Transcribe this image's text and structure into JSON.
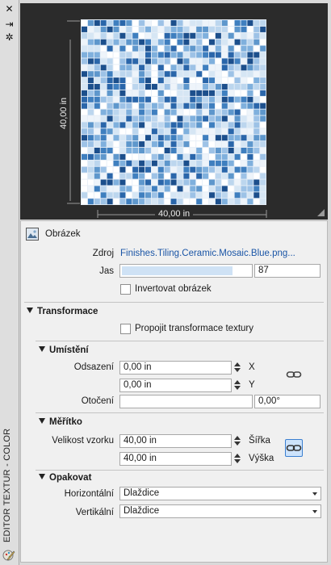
{
  "palette_title": "EDITOR TEXTUR - COLOR",
  "strip_icons": [
    "close-icon",
    "pin-icon",
    "settings-icon"
  ],
  "preview": {
    "width_label": "40,00 in",
    "height_label": "40,00 in"
  },
  "image_section": {
    "title": "Obrázek",
    "source_label": "Zdroj",
    "source_value": "Finishes.Tiling.Ceramic.Mosaic.Blue.png...",
    "brightness_label": "Jas",
    "brightness_value": "87",
    "brightness_fraction": 0.87,
    "invert_label": "Invertovat obrázek",
    "invert_checked": false
  },
  "transform_section": {
    "title": "Transformace",
    "link_label": "Propojit transformace textury",
    "link_checked": false
  },
  "placement_section": {
    "title": "Umístění",
    "offset_label": "Odsazení",
    "offset_x": "0,00 in",
    "offset_y": "0,00 in",
    "x_label": "X",
    "y_label": "Y",
    "rotation_label": "Otočení",
    "rotation_value": "0,00°"
  },
  "scale_section": {
    "title": "Měřítko",
    "size_label": "Velikost vzorku",
    "width_value": "40,00 in",
    "height_value": "40,00 in",
    "width_label": "Šířka",
    "height_label": "Výška"
  },
  "repeat_section": {
    "title": "Opakovat",
    "horizontal_label": "Horizontální",
    "horizontal_value": "Dlaždice",
    "vertical_label": "Vertikální",
    "vertical_value": "Dlaždice"
  }
}
